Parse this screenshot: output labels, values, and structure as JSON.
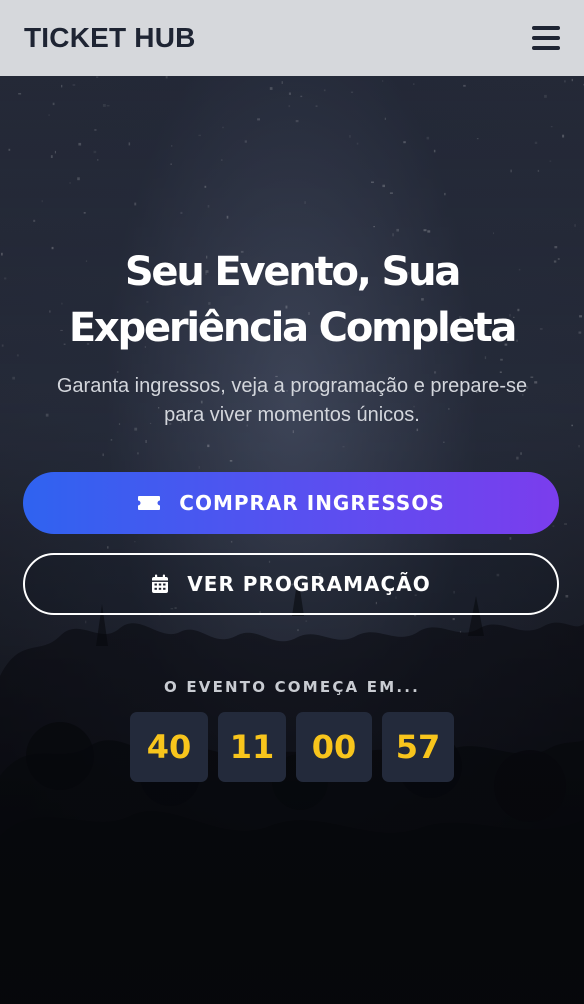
{
  "header": {
    "brand": "TICKET HUB",
    "menu_icon": "hamburger-menu-icon"
  },
  "hero": {
    "title_line1": "Seu Evento, Sua",
    "title_line2": "Experiência Completa",
    "subtitle_line1": "Garanta ingressos, veja a programação e prepare-se",
    "subtitle_line2": "para viver momentos únicos.",
    "buy_button": {
      "label": "COMPRAR INGRESSOS",
      "icon": "ticket-icon"
    },
    "schedule_button": {
      "label": "VER PROGRAMAÇÃO",
      "icon": "calendar-icon"
    }
  },
  "countdown": {
    "label": "O EVENTO COMEÇA EM...",
    "values": [
      "40",
      "11",
      "00",
      "57"
    ]
  },
  "colors": {
    "header_bg": "#d6d8dc",
    "brand_text": "#1e2433",
    "primary_gradient_start": "#2f63f0",
    "primary_gradient_end": "#7b3ded",
    "countdown_digits": "#f8c51c",
    "countdown_box": "#232a3b"
  }
}
